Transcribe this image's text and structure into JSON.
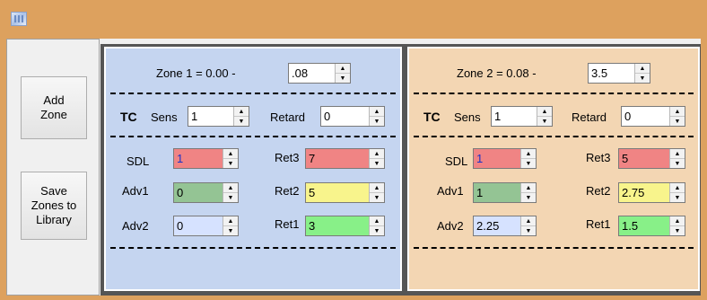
{
  "window": {
    "icon": "app-grid-icon"
  },
  "buttons": {
    "add_zone": "Add\nZone",
    "save_zones": "Save\nZones to\nLibrary"
  },
  "colors": {
    "red": "#f08484",
    "green": "#94c494",
    "blue": "#d6e2ff",
    "yellow": "#f8f48c",
    "lime": "#88f088",
    "white": "#ffffff"
  },
  "zones": [
    {
      "title": "Zone 1 = 0.00 -",
      "upper": ".08",
      "tc_label": "TC",
      "sens_label": "Sens",
      "sens": "1",
      "retard_label": "Retard",
      "retard": "0",
      "sdl_label": "SDL",
      "sdl": "1",
      "adv1_label": "Adv1",
      "adv1": "0",
      "adv2_label": "Adv2",
      "adv2": "0",
      "ret3_label": "Ret3",
      "ret3": "7",
      "ret2_label": "Ret2",
      "ret2": "5",
      "ret1_label": "Ret1",
      "ret1": "3"
    },
    {
      "title": "Zone 2 = 0.08 -",
      "upper": "3.5",
      "tc_label": "TC",
      "sens_label": "Sens",
      "sens": "1",
      "retard_label": "Retard",
      "retard": "0",
      "sdl_label": "SDL",
      "sdl": "1",
      "adv1_label": "Adv1",
      "adv1": "1",
      "adv2_label": "Adv2",
      "adv2": "2.25",
      "ret3_label": "Ret3",
      "ret3": "5",
      "ret2_label": "Ret2",
      "ret2": "2.75",
      "ret1_label": "Ret1",
      "ret1": "1.5"
    }
  ]
}
